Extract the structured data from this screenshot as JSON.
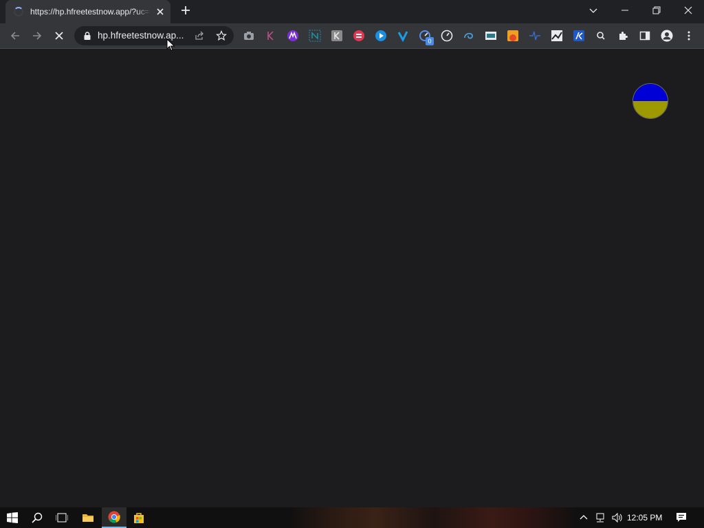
{
  "browser": {
    "tab": {
      "title": "https://hp.hfreetestnow.app/?uc="
    },
    "address_bar": {
      "url_display": "hp.hfreetestnow.ap..."
    },
    "extension_badge": "0"
  },
  "taskbar": {
    "clock": "12:05 PM"
  },
  "colors": {
    "flag_top": "#0000d6",
    "flag_bottom": "#9c9a00",
    "page_background": "#1c1c1e"
  }
}
